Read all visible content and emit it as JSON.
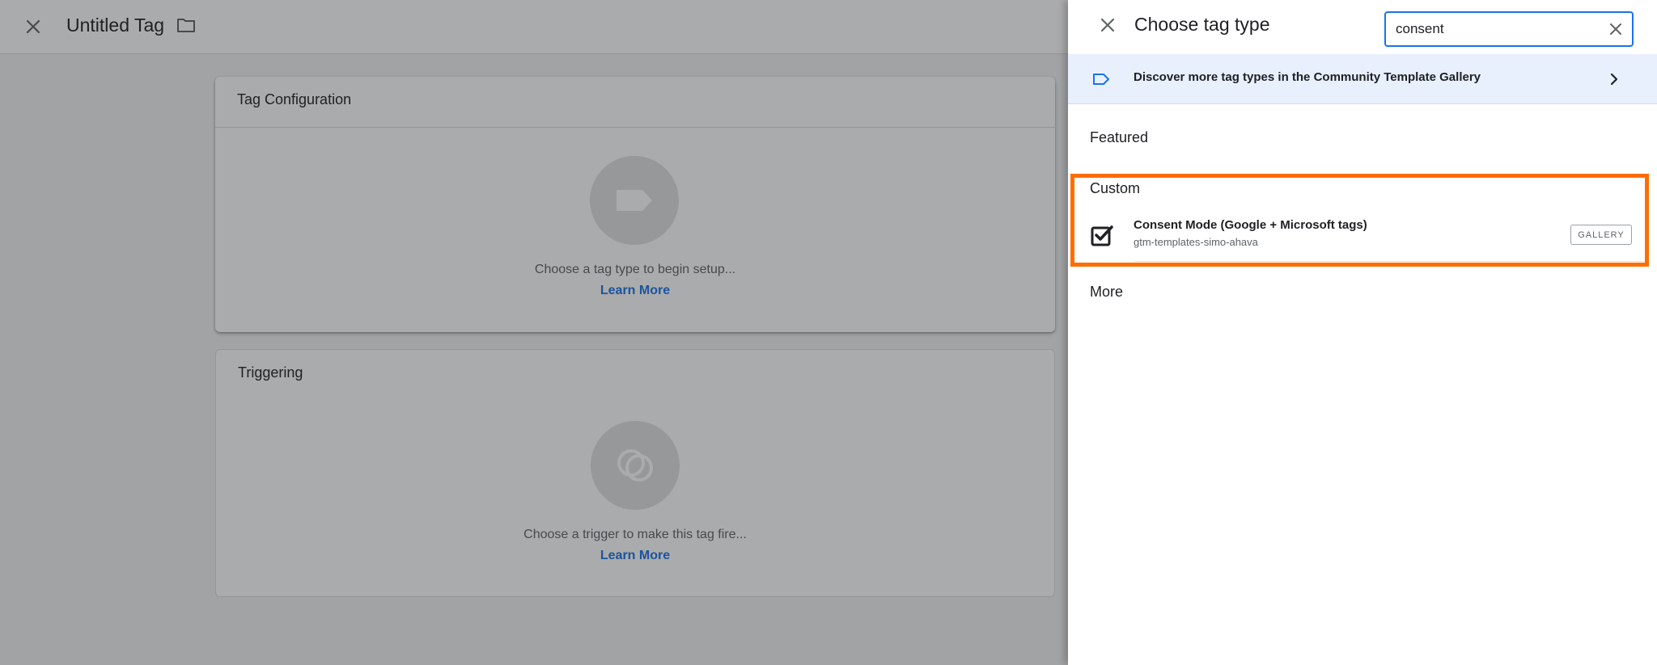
{
  "editor": {
    "title": "Untitled Tag",
    "tag_configuration": {
      "title": "Tag Configuration",
      "placeholder": "Choose a tag type to begin setup...",
      "link": "Learn More"
    },
    "triggering": {
      "title": "Triggering",
      "placeholder": "Choose a trigger to make this tag fire...",
      "link": "Learn More"
    }
  },
  "panel": {
    "title": "Choose tag type",
    "search": {
      "value": "consent",
      "placeholder": ""
    },
    "banner": {
      "text": "Discover more tag types in the Community Template Gallery"
    },
    "sections": {
      "featured": "Featured",
      "custom": "Custom",
      "more": "More"
    },
    "custom_items": [
      {
        "name": "Consent Mode (Google + Microsoft tags)",
        "author": "gtm-templates-simo-ahava",
        "badge": "GALLERY"
      }
    ]
  },
  "icons": {
    "editor_close": "close-icon",
    "folder": "folder-icon",
    "panel_close": "close-icon",
    "search_clear": "close-icon",
    "banner": "tag-outline-icon",
    "banner_chevron": "chevron-right-icon",
    "tag_item": "checkbox-checked-icon"
  },
  "colors": {
    "accent": "#1a73e8",
    "highlight": "#ff6d00",
    "banner_bg": "#e8f0fe"
  }
}
